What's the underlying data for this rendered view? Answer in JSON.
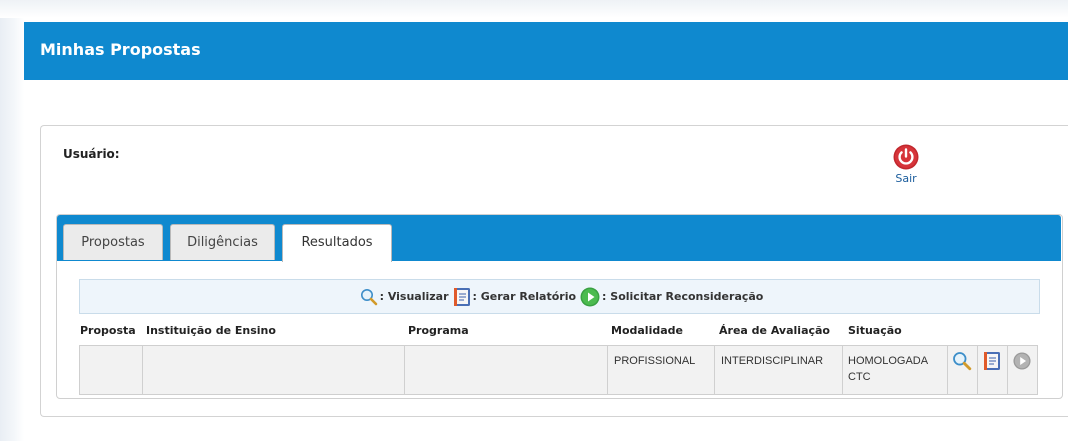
{
  "header": {
    "title": "Minhas Propostas"
  },
  "user": {
    "label": "Usuário:"
  },
  "logout": {
    "label": "Sair",
    "icon": "power-icon",
    "color": "#c1272d"
  },
  "tabs": [
    {
      "label": "Propostas",
      "active": false
    },
    {
      "label": "Diligências",
      "active": false
    },
    {
      "label": "Resultados",
      "active": true
    }
  ],
  "legend": {
    "view": {
      "icon": "magnifier-icon",
      "label": ": Visualizar"
    },
    "report": {
      "icon": "report-icon",
      "label": ": Gerar Relatório"
    },
    "reconsider": {
      "icon": "play-icon",
      "label": ": Solicitar Reconsideração"
    }
  },
  "table": {
    "columns": [
      "Proposta",
      "Instituição de Ensino",
      "Programa",
      "Modalidade",
      "Área de Avaliação",
      "Situação"
    ],
    "rows": [
      {
        "proposta": "",
        "instituicao": "",
        "programa": "",
        "modalidade": "PROFISSIONAL",
        "area": "INTERDISCIPLINAR",
        "situacao": "HOMOLOGADA CTC",
        "actions": [
          "magnifier-icon",
          "report-icon",
          "play-icon"
        ]
      }
    ]
  },
  "colors": {
    "brand": "#0f89cf",
    "logout": "#c1272d",
    "reconsider": "#3aa142"
  }
}
